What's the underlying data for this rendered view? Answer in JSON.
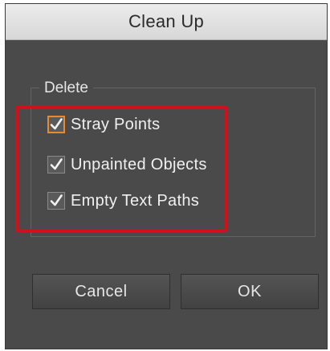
{
  "dialog": {
    "title": "Clean Up"
  },
  "group": {
    "legend": "Delete",
    "options": [
      {
        "label": "Stray Points",
        "checked": true,
        "focused": true
      },
      {
        "label": "Unpainted Objects",
        "checked": true,
        "focused": false
      },
      {
        "label": "Empty Text Paths",
        "checked": true,
        "focused": false
      }
    ]
  },
  "buttons": {
    "cancel_label": "Cancel",
    "ok_label": "OK"
  },
  "colors": {
    "dialog_bg": "#4a4a4a",
    "focus_ring": "#e98a2e",
    "highlight": "#d0101c"
  },
  "icons": {
    "checkmark": "checkmark-icon"
  }
}
